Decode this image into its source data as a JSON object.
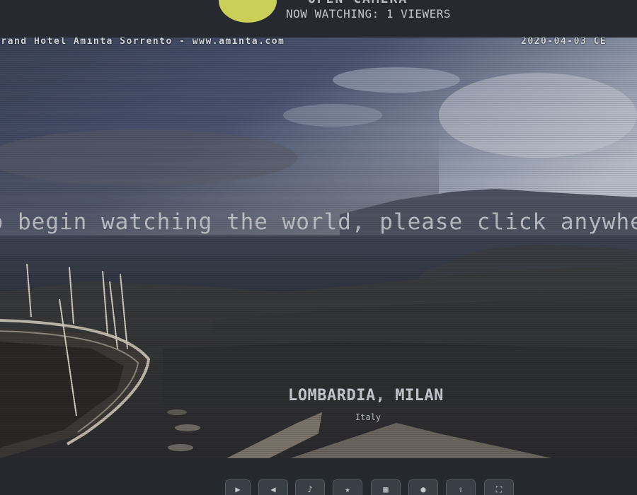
{
  "header": {
    "title": "OPEN CAMERA",
    "viewers": "NOW WATCHING: 1 VIEWERS"
  },
  "feed": {
    "camera_label": "Grand Hotel Aminta Sorrento - www.aminta.com",
    "timestamp": "2020-04-03 CE",
    "click_prompt": "To begin watching the world, please click anywhere",
    "location": "LOMBARDIA, MILAN",
    "country": "Italy"
  },
  "controls": {
    "buttons": [
      {
        "icon": "play-icon",
        "glyph": "▶"
      },
      {
        "icon": "previous-icon",
        "glyph": "◀"
      },
      {
        "icon": "volume-icon",
        "glyph": "♪"
      },
      {
        "icon": "star-icon",
        "glyph": "★"
      },
      {
        "icon": "grid-icon",
        "glyph": "▦"
      },
      {
        "icon": "record-icon",
        "glyph": "●"
      },
      {
        "icon": "share-icon",
        "glyph": "⇪"
      },
      {
        "icon": "fullscreen-icon",
        "glyph": "⛶"
      }
    ]
  },
  "colors": {
    "accent": "#c9cf57",
    "header_bg": "#262a30",
    "text": "#c3c6cc"
  }
}
